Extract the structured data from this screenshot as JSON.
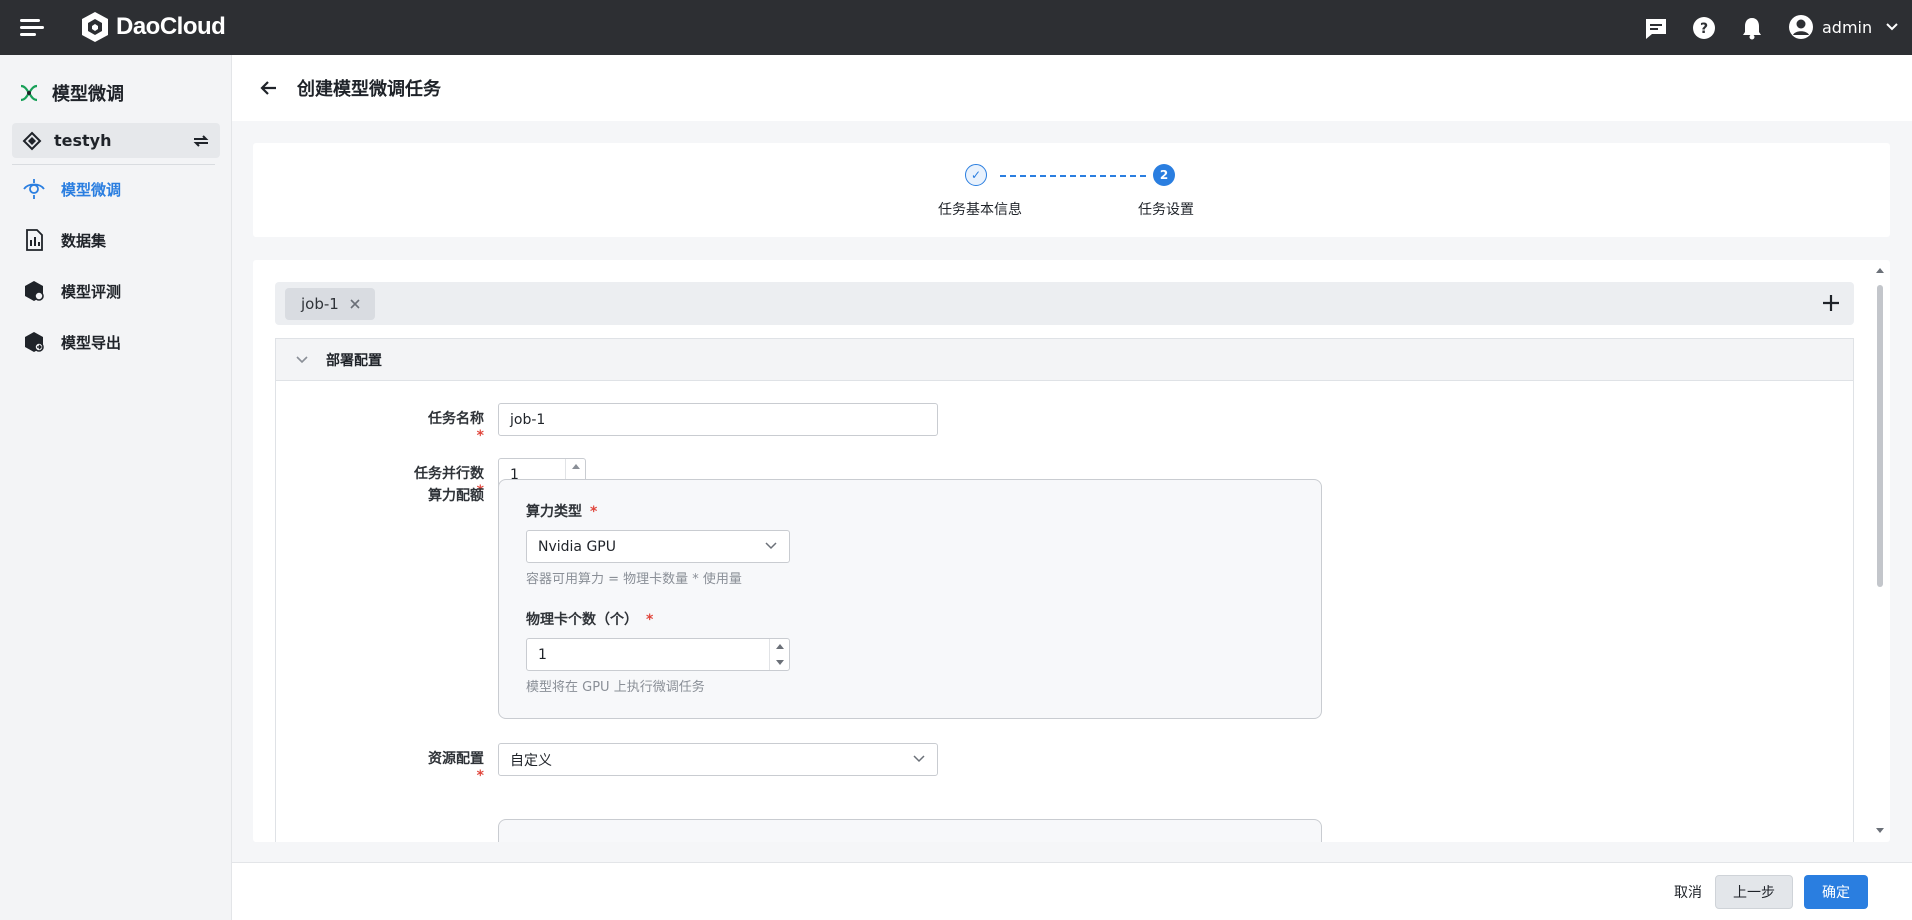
{
  "app": {
    "brand": "DaoCloud"
  },
  "topbar": {
    "user_name": "admin",
    "icons": [
      "menu-icon",
      "chat-icon",
      "help-icon",
      "bell-icon",
      "user-avatar-icon",
      "chevron-down-icon"
    ]
  },
  "sidebar": {
    "title": "模型微调",
    "workspace": "testyh",
    "items": [
      {
        "label": "模型微调",
        "icon": "fine-tune-icon",
        "active": true
      },
      {
        "label": "数据集",
        "icon": "dataset-icon",
        "active": false
      },
      {
        "label": "模型评测",
        "icon": "evaluation-icon",
        "active": false
      },
      {
        "label": "模型导出",
        "icon": "export-icon",
        "active": false
      }
    ]
  },
  "header": {
    "title": "创建模型微调任务"
  },
  "steps": [
    {
      "label": "任务基本信息",
      "status": "done",
      "marker": "✓"
    },
    {
      "label": "任务设置",
      "status": "current",
      "marker": "2"
    }
  ],
  "tabs": [
    {
      "label": "job-1"
    }
  ],
  "section": {
    "title": "部署配置"
  },
  "form": {
    "task_name": {
      "label": "任务名称",
      "value": "job-1"
    },
    "parallel": {
      "label": "任务并行数",
      "value": "1"
    },
    "quota": {
      "label": "算力配额",
      "compute_type": {
        "label": "算力类型",
        "value": "Nvidia GPU",
        "hint": "容器可用算力 = 物理卡数量 * 使用量"
      },
      "card_count": {
        "label": "物理卡个数（个）",
        "value": "1",
        "hint": "模型将在 GPU 上执行微调任务"
      }
    },
    "resource": {
      "label": "资源配置",
      "value": "自定义"
    }
  },
  "footer": {
    "cancel": "取消",
    "prev": "上一步",
    "confirm": "确定"
  },
  "colors": {
    "accent": "#2a7ee0",
    "topbar": "#2d2f33",
    "required": "#e0453b"
  }
}
